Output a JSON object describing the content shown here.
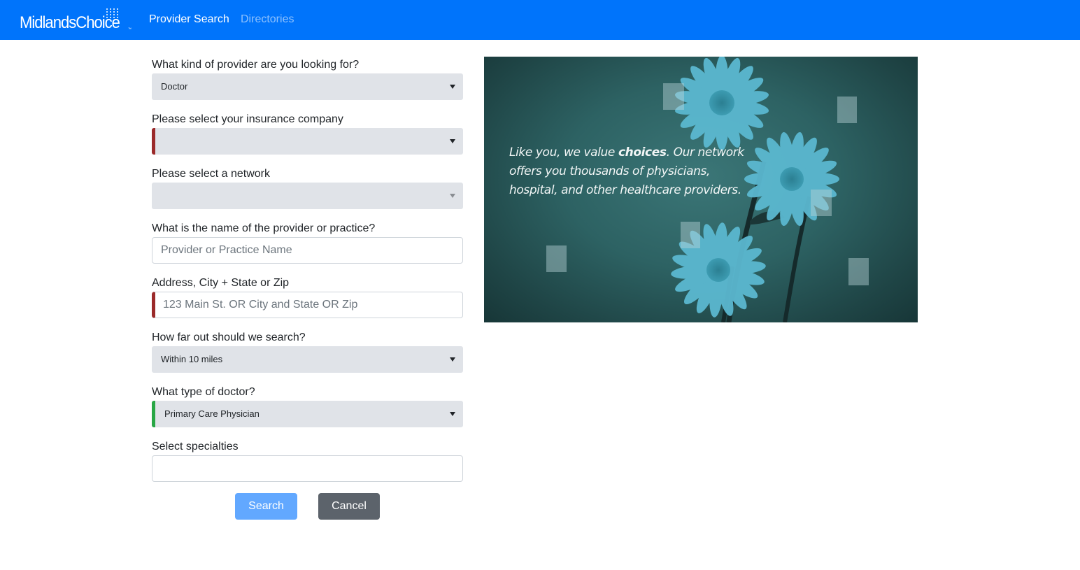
{
  "navbar": {
    "brand": "MidlandsChoice",
    "brand_tm": "™",
    "links": [
      "Provider Search",
      "Directories"
    ]
  },
  "form": {
    "provider_kind": {
      "label": "What kind of provider are you looking for?",
      "value": "Doctor"
    },
    "insurance": {
      "label": "Please select your insurance company",
      "value": ""
    },
    "network": {
      "label": "Please select a network",
      "value": ""
    },
    "name": {
      "label": "What is the name of the provider or practice?",
      "placeholder": "Provider or Practice Name"
    },
    "address": {
      "label": "Address, City + State or Zip",
      "placeholder": "123 Main St. OR City and State OR Zip"
    },
    "distance": {
      "label": "How far out should we search?",
      "value": "Within 10 miles"
    },
    "doctor_type": {
      "label": "What type of doctor?",
      "value": "Primary Care Physician"
    },
    "specialties": {
      "label": "Select specialties",
      "value": ""
    }
  },
  "buttons": {
    "search": "Search",
    "cancel": "Cancel"
  },
  "hero": {
    "text_before": "Like you, we value ",
    "text_bold": "choices",
    "text_after": ". Our network offers you thousands of physicians, hospital, and other healthcare providers."
  },
  "colors": {
    "navbar": "#0074fb",
    "invalid": "#9b2a2a",
    "valid": "#28a745",
    "search_button": "#62a8ff",
    "cancel_button": "#5c636b",
    "hero_bg": "#2d6263",
    "flower": "#5bb8d0"
  }
}
